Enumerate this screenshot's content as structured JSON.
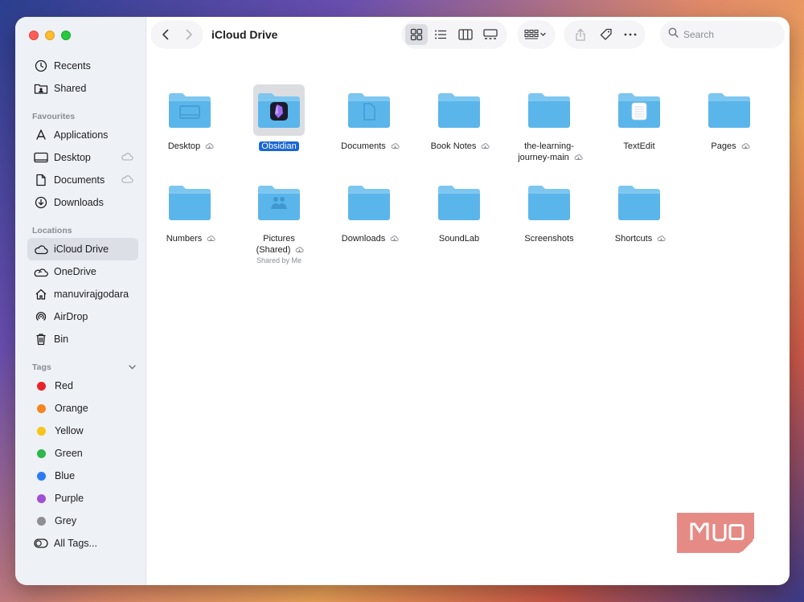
{
  "window": {
    "title": "iCloud Drive"
  },
  "sidebar": {
    "top_items": [
      {
        "label": "Recents",
        "icon": "clock-icon"
      },
      {
        "label": "Shared",
        "icon": "shared-folder-icon"
      }
    ],
    "favourites_heading": "Favourites",
    "favourites": [
      {
        "label": "Applications",
        "icon": "applications-icon",
        "cloud": false
      },
      {
        "label": "Desktop",
        "icon": "desktop-icon",
        "cloud": true
      },
      {
        "label": "Documents",
        "icon": "document-icon",
        "cloud": true
      },
      {
        "label": "Downloads",
        "icon": "download-icon",
        "cloud": false
      }
    ],
    "locations_heading": "Locations",
    "locations": [
      {
        "label": "iCloud Drive",
        "icon": "cloud-icon",
        "active": true
      },
      {
        "label": "OneDrive",
        "icon": "onedrive-icon",
        "active": false
      },
      {
        "label": "manuvirajgodara",
        "icon": "home-icon",
        "active": false
      },
      {
        "label": "AirDrop",
        "icon": "airdrop-icon",
        "active": false
      },
      {
        "label": "Bin",
        "icon": "trash-icon",
        "active": false
      }
    ],
    "tags_heading": "Tags",
    "tags": [
      {
        "label": "Red",
        "color": "#e8242b"
      },
      {
        "label": "Orange",
        "color": "#f5861f"
      },
      {
        "label": "Yellow",
        "color": "#f5c518"
      },
      {
        "label": "Green",
        "color": "#2cb84a"
      },
      {
        "label": "Blue",
        "color": "#2d7bf4"
      },
      {
        "label": "Purple",
        "color": "#a04fd6"
      },
      {
        "label": "Grey",
        "color": "#8e8e93"
      }
    ],
    "all_tags_label": "All Tags..."
  },
  "search": {
    "placeholder": "Search"
  },
  "files": [
    {
      "name": "Desktop",
      "cloud": true,
      "glyph": "desktop"
    },
    {
      "name": "Obsidian",
      "cloud": false,
      "glyph": "obsidian",
      "selected": true
    },
    {
      "name": "Documents",
      "cloud": true,
      "glyph": "doc"
    },
    {
      "name": "Book Notes",
      "cloud": true,
      "glyph": "none"
    },
    {
      "name_line1": "the-learning-",
      "name_line2": "journey-main",
      "cloud": true,
      "glyph": "none"
    },
    {
      "name": "TextEdit",
      "cloud": false,
      "glyph": "textedit"
    },
    {
      "name": "Pages",
      "cloud": true,
      "glyph": "none"
    },
    {
      "name": "Numbers",
      "cloud": true,
      "glyph": "none"
    },
    {
      "name_line1": "Pictures",
      "name_line2": "(Shared)",
      "cloud": true,
      "glyph": "people",
      "sub": "Shared by Me"
    },
    {
      "name": "Downloads",
      "cloud": true,
      "glyph": "none"
    },
    {
      "name": "SoundLab",
      "cloud": false,
      "glyph": "none"
    },
    {
      "name": "Screenshots",
      "cloud": false,
      "glyph": "none"
    },
    {
      "name": "Shortcuts",
      "cloud": true,
      "glyph": "none"
    }
  ],
  "watermark": {
    "text": "MUO",
    "color": "#e58a85"
  },
  "colors": {
    "folder_front": "#5ab5ea",
    "folder_back": "#7cc6f0",
    "accent": "#1a66d6"
  }
}
